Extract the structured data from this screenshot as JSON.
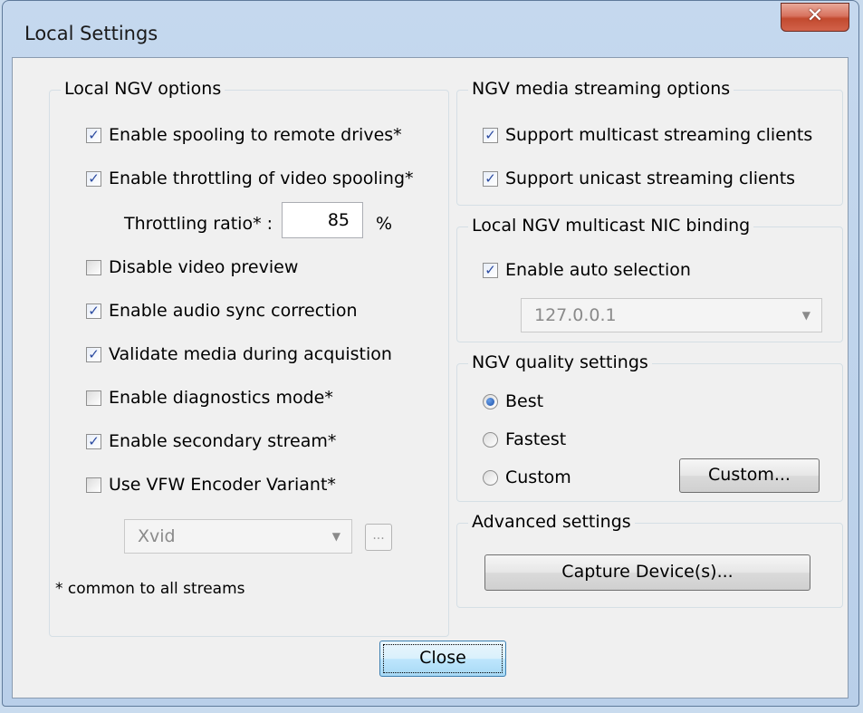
{
  "window": {
    "title": "Local Settings",
    "close_glyph": "✕"
  },
  "local_options": {
    "legend": "Local NGV options",
    "items": [
      {
        "label": "Enable spooling to remote drives*",
        "checked": true
      },
      {
        "label": "Enable throttling of video spooling*",
        "checked": true
      },
      {
        "label": "Disable video preview",
        "checked": false
      },
      {
        "label": "Enable audio sync correction",
        "checked": true
      },
      {
        "label": "Validate media during acquistion",
        "checked": true
      },
      {
        "label": "Enable diagnostics mode*",
        "checked": false
      },
      {
        "label": "Enable secondary stream*",
        "checked": true
      },
      {
        "label": "Use VFW Encoder Variant*",
        "checked": false
      }
    ],
    "throttling_label": "Throttling ratio* :",
    "throttling_value": "85",
    "throttling_unit": "%",
    "encoder_value": "Xvid",
    "encoder_more": "...",
    "footnote": "* common to all streams"
  },
  "streaming": {
    "legend": "NGV media streaming options",
    "items": [
      {
        "label": "Support multicast streaming clients",
        "checked": true
      },
      {
        "label": "Support unicast streaming clients",
        "checked": true
      }
    ]
  },
  "nic": {
    "legend": "Local NGV multicast NIC binding",
    "auto_label": "Enable auto selection",
    "auto_checked": true,
    "address": "127.0.0.1"
  },
  "quality": {
    "legend": "NGV quality settings",
    "options": [
      {
        "label": "Best",
        "selected": true
      },
      {
        "label": "Fastest",
        "selected": false
      },
      {
        "label": "Custom",
        "selected": false
      }
    ],
    "custom_button": "Custom..."
  },
  "advanced": {
    "legend": "Advanced settings",
    "capture_button": "Capture Device(s)..."
  },
  "footer": {
    "close_button": "Close"
  },
  "glyphs": {
    "check": "✓",
    "dropdown": "▼"
  }
}
